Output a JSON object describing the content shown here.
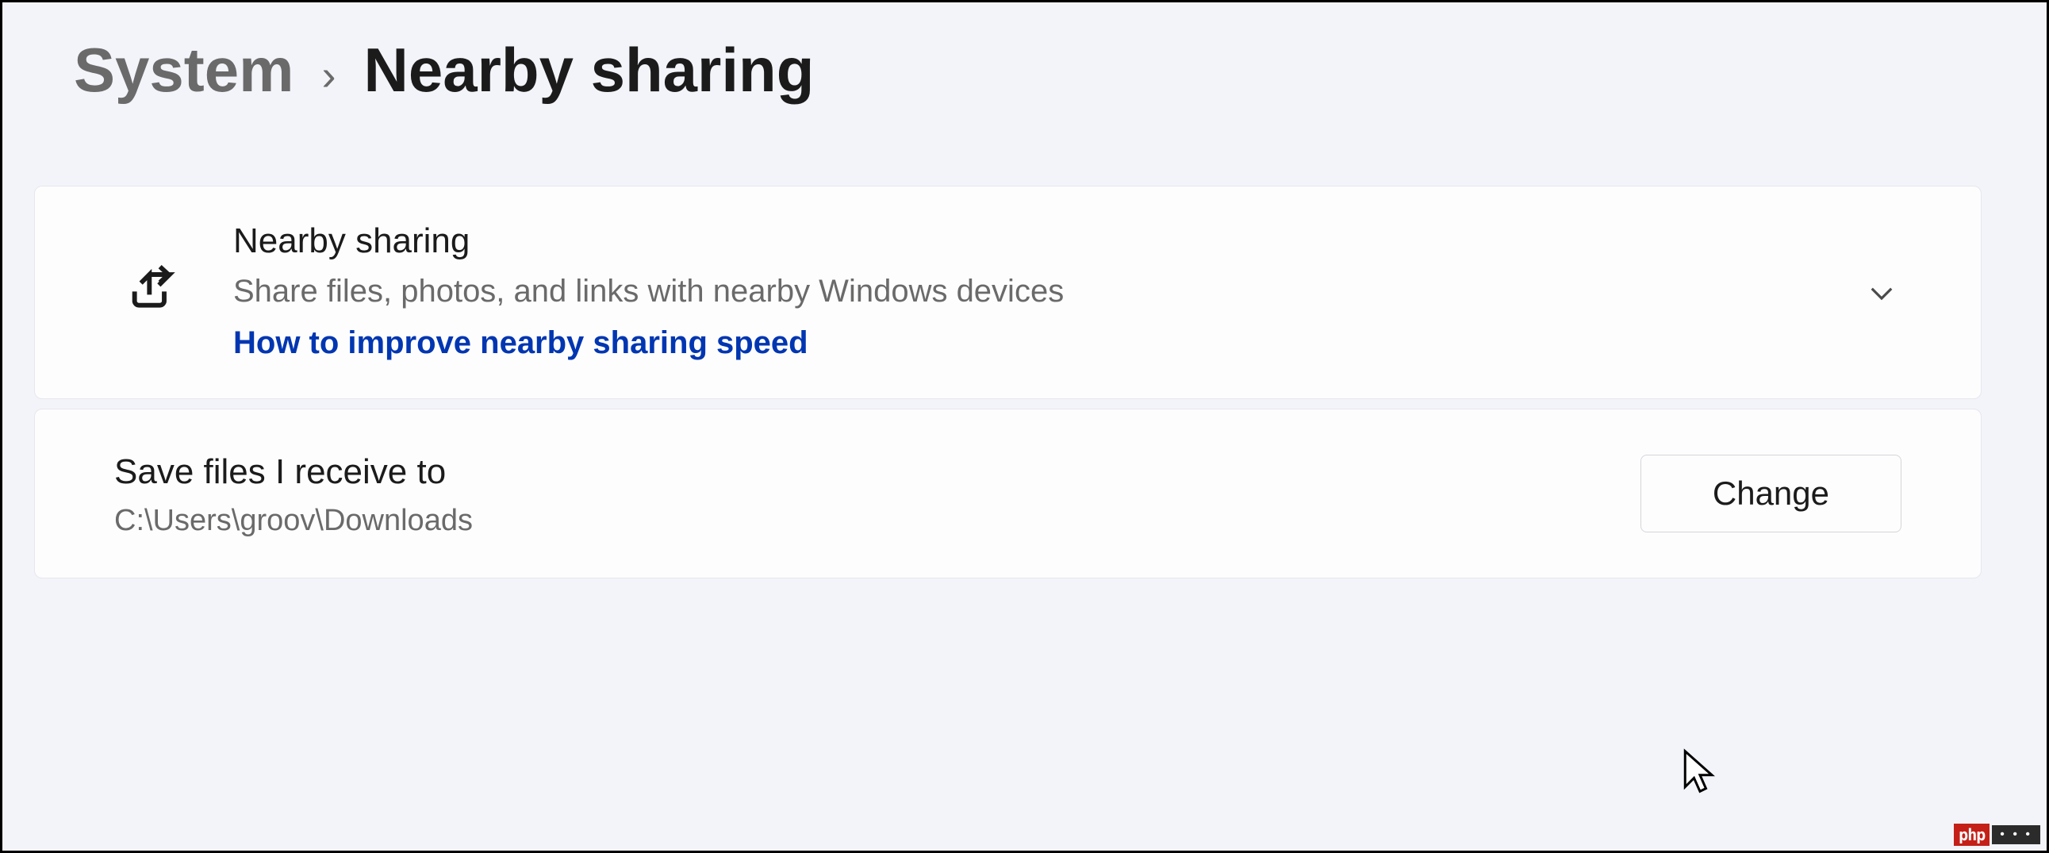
{
  "breadcrumb": {
    "parent": "System",
    "current": "Nearby sharing"
  },
  "nearbySharing": {
    "title": "Nearby sharing",
    "subtitle": "Share files, photos, and links with nearby Windows devices",
    "helpLink": "How to improve nearby sharing speed"
  },
  "savePath": {
    "label": "Save files I receive to",
    "path": "C:\\Users\\groov\\Downloads",
    "buttonLabel": "Change"
  },
  "watermark": {
    "left": "php",
    "right": "• • •"
  }
}
